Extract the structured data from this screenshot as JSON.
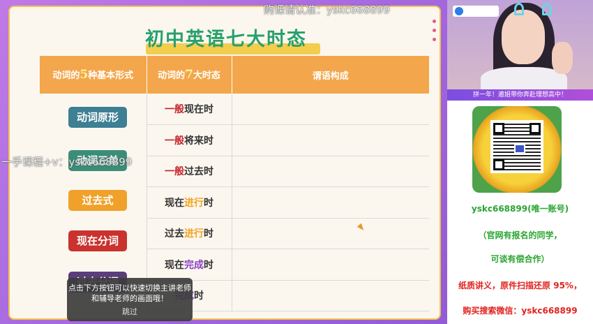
{
  "slide": {
    "title": "初中英语七大时态",
    "header_forms_pre": "动词的",
    "header_forms_num": "5",
    "header_forms_post": "种基本形式",
    "header_tenses_pre": "动词的",
    "header_tenses_num": "7",
    "header_tenses_post": "大时态",
    "header_predicate": "谓语构成",
    "forms": [
      {
        "label": "动词原形",
        "color": "#3d7f93"
      },
      {
        "label": "动词三单",
        "color": "#3b8d78"
      },
      {
        "label": "过去式",
        "color": "#f0a12a"
      },
      {
        "label": "现在分词",
        "color": "#c9322e"
      },
      {
        "label": "过去分词",
        "color": "#5a3e7a"
      }
    ],
    "tenses": [
      {
        "hl": "一般",
        "rest": "现在时",
        "hl_class": "red",
        "pre": ""
      },
      {
        "hl": "一般",
        "rest": "将来时",
        "hl_class": "red",
        "pre": ""
      },
      {
        "hl": "一般",
        "rest": "过去时",
        "hl_class": "red",
        "pre": ""
      },
      {
        "pre": "现在",
        "hl": "进行",
        "rest": "时",
        "hl_class": "orange"
      },
      {
        "pre": "过去",
        "hl": "进行",
        "rest": "时",
        "hl_class": "orange"
      },
      {
        "pre": "现在",
        "hl": "完成",
        "rest": "时",
        "hl_class": "purple"
      },
      {
        "pre": "",
        "hl": "完成",
        "rest": "时",
        "hl_class": "purple"
      }
    ]
  },
  "watermarks": {
    "top": "购课请认准：yskc668899",
    "left": "一手课程+v：yskc668899"
  },
  "tooltip": {
    "message": "点击下方按钮可以快速切换主讲老师和辅导老师的画面哦！",
    "skip_label": "跳过"
  },
  "sidebar": {
    "promo_strip": "拼一年！邀姐带你奔赴理想高中！",
    "account": "yskc668899(唯一账号)",
    "line1": "（官网有报名的同学，",
    "line2": "可谈有偿合作）",
    "line3": "纸质讲义，原件扫描还原 95%，",
    "line4": "购买搜索微信：yskc668899"
  }
}
